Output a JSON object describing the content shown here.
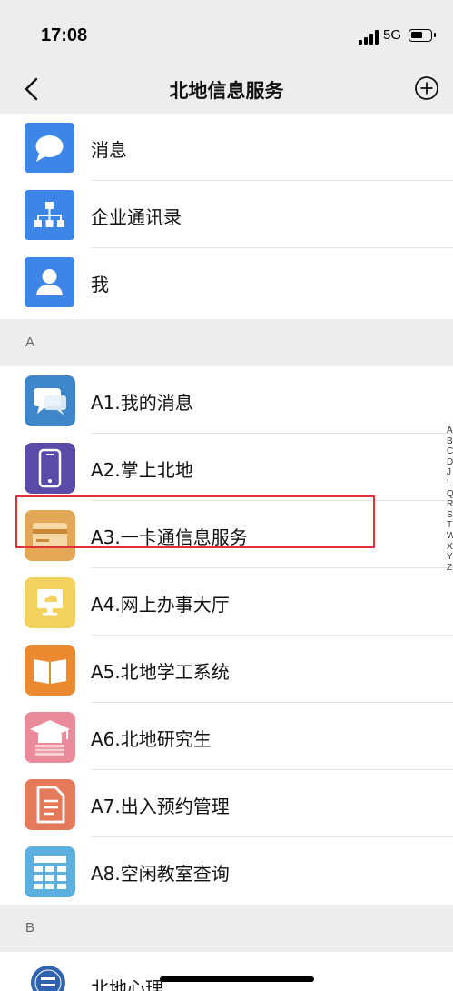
{
  "status_bar": {
    "time": "17:08",
    "network": "5G"
  },
  "nav": {
    "title": "北地信息服务",
    "back_icon": "chevron-left-icon",
    "add_icon": "plus-circle-icon"
  },
  "fixed_items": [
    {
      "label": "消息",
      "icon": "chat-bubble-icon",
      "color": "#3d86e8"
    },
    {
      "label": "企业通讯录",
      "icon": "org-chart-icon",
      "color": "#3d86e8"
    },
    {
      "label": "我",
      "icon": "person-icon",
      "color": "#3d86e8"
    }
  ],
  "sections": [
    {
      "letter": "A",
      "items": [
        {
          "label": "A1.我的消息",
          "icon": "message-bubbles-icon",
          "color": "#3e86c9"
        },
        {
          "label": "A2.掌上北地",
          "icon": "phone-icon",
          "color": "#5b4ba8"
        },
        {
          "label": "A3.一卡通信息服务",
          "icon": "card-icon",
          "color": "#e3a756"
        },
        {
          "label": "A4.网上办事大厅",
          "icon": "monitor-cloud-icon",
          "color": "#f3d15f"
        },
        {
          "label": "A5.北地学工系统",
          "icon": "book-icon",
          "color": "#ec8a2f"
        },
        {
          "label": "A6.北地研究生",
          "icon": "graduation-cap-icon",
          "color": "#e98b9a"
        },
        {
          "label": "A7.出入预约管理",
          "icon": "document-icon",
          "color": "#e47a5a"
        },
        {
          "label": "A8.空闲教室查询",
          "icon": "table-grid-icon",
          "color": "#5cb0e0"
        }
      ]
    },
    {
      "letter": "B",
      "items": [
        {
          "label": "北地心理",
          "icon": "psychology-logo-icon",
          "color": "#2f63b0"
        }
      ]
    }
  ],
  "index_letters": [
    "A",
    "B",
    "C",
    "D",
    "J",
    "L",
    "Q",
    "R",
    "S",
    "T",
    "W",
    "X",
    "Y",
    "Z"
  ],
  "accent": "#e0313b"
}
